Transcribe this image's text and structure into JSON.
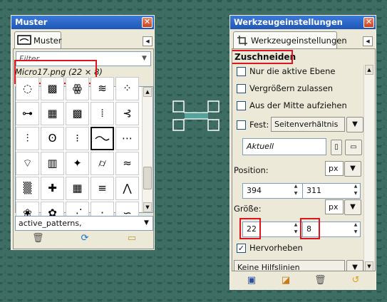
{
  "patterns_dock": {
    "title": "Muster",
    "tab_label": "Muster",
    "filter_placeholder": "Filter",
    "selected_pattern": "Micro17.png (22 × 8)",
    "tag_value": "active_patterns,"
  },
  "tool_options_dock": {
    "title": "Werkzeugeinstellungen",
    "tab_label": "Werkzeugeinstellungen",
    "tool_name": "Zuschneiden",
    "options": {
      "active_layer_only": "Nur die aktive Ebene",
      "allow_growing": "Vergrößern zulassen",
      "expand_from_center": "Aus der Mitte aufziehen",
      "fixed_label": "Fest:",
      "fixed_mode": "Seitenverhältnis",
      "current_value": "Aktuell",
      "position_label": "Position:",
      "position_unit": "px",
      "position_x": "394",
      "position_y": "311",
      "size_label": "Größe:",
      "size_unit": "px",
      "size_w": "22",
      "size_h": "8",
      "highlight_label": "Hervorheben",
      "guides_value": "Keine Hilfslinien"
    },
    "checked": {
      "active_layer_only": false,
      "allow_growing": false,
      "expand_from_center": false,
      "fixed": false,
      "highlight": true
    }
  },
  "colors": {
    "titlebar": "#2563c9",
    "annotation_box": "#e0141e",
    "selection_handle_fill": "#5fb5ad"
  }
}
